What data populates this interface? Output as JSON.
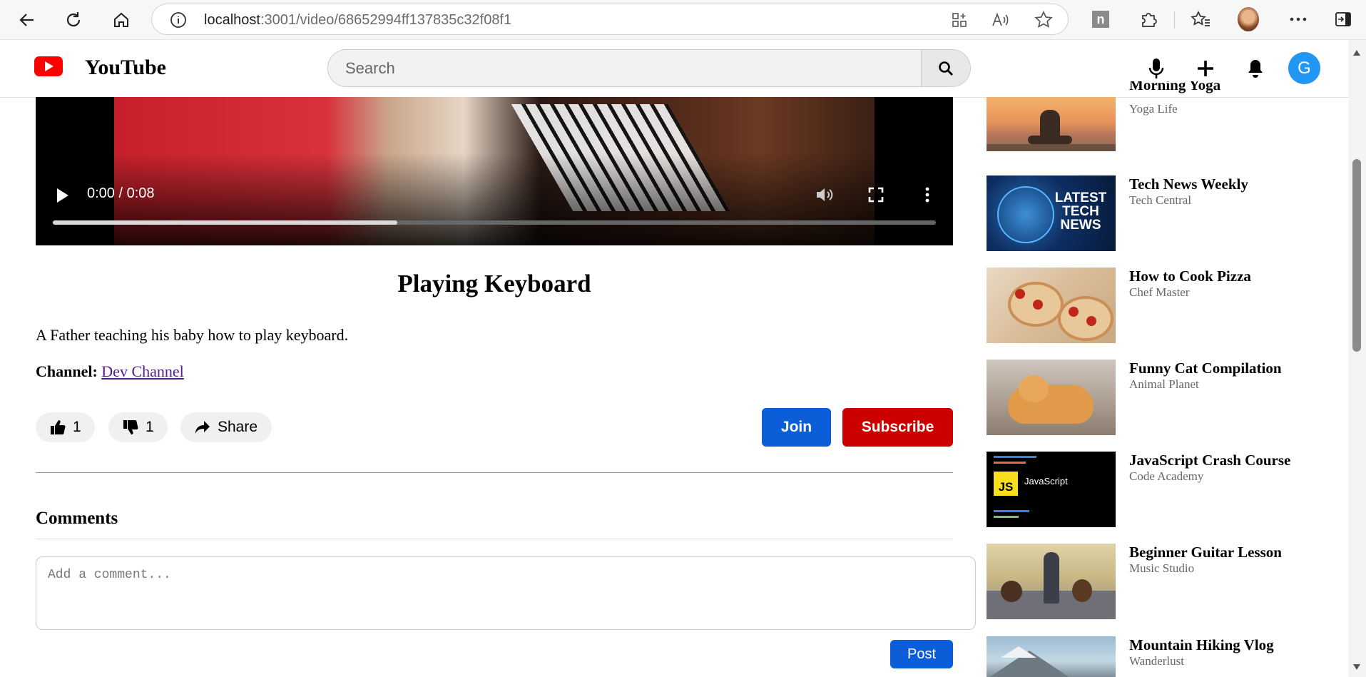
{
  "browser": {
    "url_host": "localhost",
    "url_path": ":3001/video/68652994ff137835c32f08f1"
  },
  "header": {
    "logo_text": "YouTube",
    "search_placeholder": "Search",
    "avatar_letter": "G"
  },
  "video": {
    "time": "0:00 / 0:08",
    "progress": 0.39,
    "title": "Playing Keyboard",
    "description": "A Father teaching his baby how to play keyboard.",
    "channel_label": "Channel:",
    "channel_name": "Dev Channel",
    "likes": "1",
    "dislikes": "1",
    "share_label": "Share",
    "join_label": "Join",
    "subscribe_label": "Subscribe"
  },
  "comments": {
    "heading": "Comments",
    "placeholder": "Add a comment...",
    "post_label": "Post"
  },
  "colors": {
    "join": "#0b5ed7",
    "subscribe": "#cc0000",
    "avatar": "#2196f3",
    "brand_red": "#ff0000"
  },
  "suggestions": [
    {
      "title": "Morning Yoga",
      "channel": "Yoga Life",
      "thumb": "yoga"
    },
    {
      "title": "Tech News Weekly",
      "channel": "Tech Central",
      "thumb": "tech-news",
      "thumb_text": "LATEST TECH NEWS"
    },
    {
      "title": "How to Cook Pizza",
      "channel": "Chef Master",
      "thumb": "pizza"
    },
    {
      "title": "Funny Cat Compilation",
      "channel": "Animal Planet",
      "thumb": "cat"
    },
    {
      "title": "JavaScript Crash Course",
      "channel": "Code Academy",
      "thumb": "javascript",
      "thumb_badge": "JS",
      "thumb_text": "JavaScript"
    },
    {
      "title": "Beginner Guitar Lesson",
      "channel": "Music Studio",
      "thumb": "guitar"
    },
    {
      "title": "Mountain Hiking Vlog",
      "channel": "Wanderlust",
      "thumb": "mountain"
    }
  ]
}
